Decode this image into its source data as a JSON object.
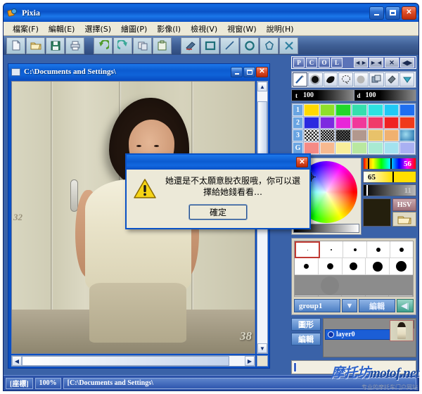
{
  "app": {
    "title": "Pixia",
    "icon": "pixia-app-icon",
    "window_buttons": [
      {
        "name": "minimize",
        "glyph": "_"
      },
      {
        "name": "maximize",
        "glyph": "▢"
      },
      {
        "name": "close",
        "glyph": "✕"
      }
    ]
  },
  "menu": {
    "items": [
      {
        "label": "檔案(F)",
        "name": "menu-file"
      },
      {
        "label": "編輯(E)",
        "name": "menu-edit"
      },
      {
        "label": "選擇(S)",
        "name": "menu-select"
      },
      {
        "label": "繪圖(P)",
        "name": "menu-draw"
      },
      {
        "label": "影像(I)",
        "name": "menu-image"
      },
      {
        "label": "檢視(V)",
        "name": "menu-view"
      },
      {
        "label": "視窗(W)",
        "name": "menu-window"
      },
      {
        "label": "說明(H)",
        "name": "menu-help"
      }
    ]
  },
  "toolbar": {
    "buttons": [
      {
        "name": "new-file-icon",
        "title": "new"
      },
      {
        "name": "open-folder-icon",
        "title": "open"
      },
      {
        "name": "save-disk-icon",
        "title": "save"
      },
      {
        "name": "print-icon",
        "title": "print"
      },
      {
        "name": "undo-icon",
        "title": "undo"
      },
      {
        "name": "redo-icon",
        "title": "redo"
      },
      {
        "name": "copy-icon",
        "title": "copy"
      },
      {
        "name": "paste-icon",
        "title": "paste"
      },
      {
        "name": "eraser-icon",
        "title": "eraser"
      },
      {
        "name": "rectangle-icon",
        "title": "rectangle"
      },
      {
        "name": "line-icon",
        "title": "line"
      },
      {
        "name": "circle-icon",
        "title": "circle"
      },
      {
        "name": "polygon-icon",
        "title": "polygon"
      },
      {
        "name": "cancel-x-icon",
        "title": "cancel"
      }
    ]
  },
  "document": {
    "title": "C:\\Documents and Settings\\",
    "photo_number": "38",
    "tag_number": "32"
  },
  "dialog": {
    "message": "她還是不太願意脫衣服哦，你可以選擇給她錢看看…",
    "ok_label": "確定",
    "close_glyph": "✕",
    "icon": "warning-triangle-icon"
  },
  "right_panel": {
    "mode_buttons": [
      {
        "label": "P",
        "name": "panel-btn-p"
      },
      {
        "label": "C",
        "name": "panel-btn-c"
      },
      {
        "label": "O",
        "name": "panel-btn-o"
      },
      {
        "label": "L",
        "name": "panel-btn-l"
      }
    ],
    "nav_buttons": [
      {
        "label": "◄►",
        "name": "panel-btn-expand-h"
      },
      {
        "label": "►◄",
        "name": "panel-btn-collapse-h"
      },
      {
        "label": "✕",
        "name": "panel-btn-close"
      },
      {
        "label": "◀▶",
        "name": "panel-btn-toggle"
      }
    ],
    "tools": [
      {
        "name": "pencil-tool-icon",
        "selected": true
      },
      {
        "name": "airbrush-tool-icon",
        "selected": false
      },
      {
        "name": "blob-tool-icon",
        "selected": false
      },
      {
        "name": "lasso-tool-icon",
        "selected": false
      },
      {
        "name": "soft-brush-tool-icon",
        "selected": false
      },
      {
        "name": "layers-tool-icon",
        "selected": false
      },
      {
        "name": "eraser-tool-icon",
        "selected": false
      },
      {
        "name": "dropdown-tool-icon",
        "selected": false
      }
    ],
    "opacity": {
      "tone_label": "t",
      "tone_value": "100",
      "density_label": "d",
      "density_value": "100"
    },
    "palette": {
      "rows": [
        {
          "label": "1",
          "colors": [
            "#ffd900",
            "#8fe02a",
            "#22d72a",
            "#35dfae",
            "#2ee2e2",
            "#20c9f5",
            "#1f6ff0"
          ]
        },
        {
          "label": "2",
          "colors": [
            "#2a2ae0",
            "#7d2ae0",
            "#e826d8",
            "#f0389a",
            "#f03a6a",
            "#ef2222",
            "#f03a1a"
          ]
        },
        {
          "label": "3",
          "colors": [
            "#ffffff",
            "#dcdcdc",
            "#1a1a1a",
            "#b2988e",
            "#e8c26a",
            "#f0b170",
            "#2a7fd0"
          ]
        },
        {
          "label": "G",
          "colors": [
            "#f58a85",
            "#f7b98f",
            "#f9ee9a",
            "#b9e8a0",
            "#a8ead2",
            "#a3e2ef",
            "#a9b0f2"
          ]
        }
      ]
    },
    "hsv": {
      "hue": "56",
      "saturation": "65",
      "value": "11",
      "mode_label": "HSV",
      "open_icon": "folder-open-icon",
      "current_color": "#241f0d"
    },
    "brush": {
      "group_label": "group1",
      "edit_label": "編輯",
      "dropdown_icon": "chevron-down-icon",
      "play_icon": "play-left-icon",
      "sizes_row1": [
        1,
        2,
        3,
        5,
        6
      ],
      "sizes_row2": [
        7,
        9,
        11,
        14,
        15
      ]
    },
    "layers": {
      "shape_label": "圖形",
      "edit_label": "編輯",
      "items": [
        {
          "name": "layer0",
          "visible": true
        }
      ],
      "toolbar_icons": [
        "layer-toggle-icon"
      ]
    }
  },
  "status_bar": {
    "coords": "[座標]",
    "zoom": "100%",
    "path": "[C:\\Documents and Settings\\"
  },
  "watermark": {
    "cn": "摩托坊",
    "en": "motof.net",
    "sub": "专业的摩托车门户网站"
  },
  "colors": {
    "title_blue": "#0a4fc4",
    "menu_bg": "#ece9d8",
    "workspace": "#3a62a8",
    "status_bg": "#2c52a8",
    "accent_red": "#c03a33"
  }
}
